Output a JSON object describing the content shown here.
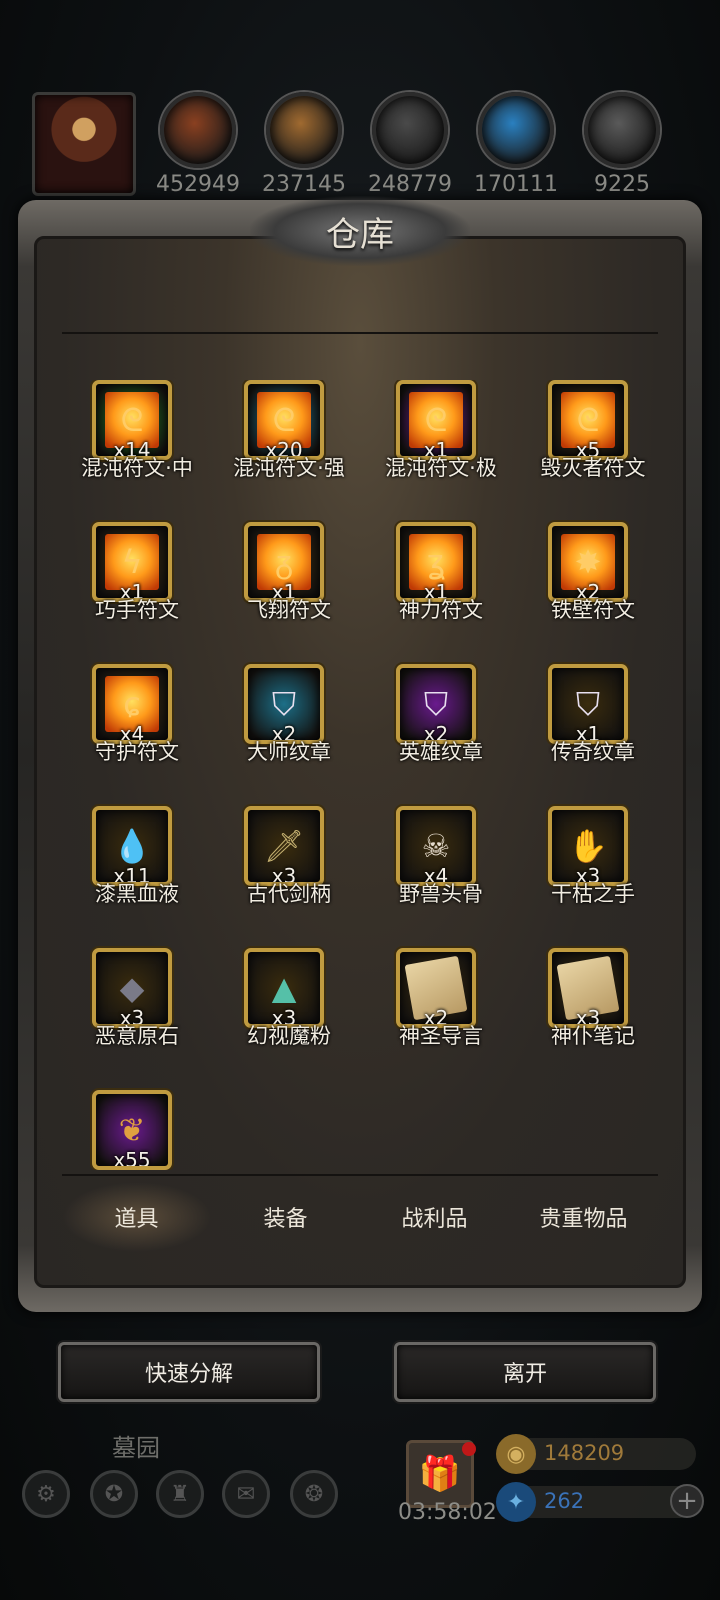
{
  "resources": [
    {
      "icon": "meat-icon",
      "value": "452949",
      "color": "#8a4020"
    },
    {
      "icon": "wood-icon",
      "value": "237145",
      "color": "#a06a30"
    },
    {
      "icon": "stone-icon",
      "value": "248779",
      "color": "#4a4a4a"
    },
    {
      "icon": "crystal-icon",
      "value": "170111",
      "color": "#2a80c0"
    },
    {
      "icon": "iron-icon",
      "value": "9225",
      "color": "#5a5a5a"
    }
  ],
  "panel": {
    "title": "仓库"
  },
  "items": [
    {
      "name": "混沌符文·中",
      "qty": "x14",
      "rarity": "green",
      "glyph": "ᘓ",
      "kind": "rune",
      "icon": "chaos-rune-icon"
    },
    {
      "name": "混沌符文·强",
      "qty": "x20",
      "rarity": "blue",
      "glyph": "ᘓ",
      "kind": "rune",
      "icon": "chaos-rune-icon"
    },
    {
      "name": "混沌符文·极",
      "qty": "x1",
      "rarity": "purple",
      "glyph": "ᘓ",
      "kind": "rune",
      "icon": "chaos-rune-icon"
    },
    {
      "name": "毁灭者符文",
      "qty": "x5",
      "rarity": "gold",
      "glyph": "ᘓ",
      "kind": "rune",
      "icon": "destroyer-rune-icon"
    },
    {
      "name": "巧手符文",
      "qty": "x1",
      "rarity": "gold",
      "glyph": "ϟ",
      "kind": "rune",
      "icon": "dexterity-rune-icon"
    },
    {
      "name": "飞翔符文",
      "qty": "x1",
      "rarity": "gold",
      "glyph": "ᵹ",
      "kind": "rune",
      "icon": "flight-rune-icon"
    },
    {
      "name": "神力符文",
      "qty": "x1",
      "rarity": "gold",
      "glyph": "ʓ",
      "kind": "rune",
      "icon": "power-rune-icon"
    },
    {
      "name": "铁壁符文",
      "qty": "x2",
      "rarity": "gold",
      "glyph": "✸",
      "kind": "rune",
      "icon": "iron-wall-rune-icon"
    },
    {
      "name": "守护符文",
      "qty": "x4",
      "rarity": "gold",
      "glyph": "ɕ",
      "kind": "rune",
      "icon": "guard-rune-icon"
    },
    {
      "name": "大师纹章",
      "qty": "x2",
      "rarity": "blue",
      "glyph": "⛉",
      "kind": "badge",
      "icon": "master-emblem-icon"
    },
    {
      "name": "英雄纹章",
      "qty": "x2",
      "rarity": "purple",
      "glyph": "⛉",
      "kind": "badge",
      "icon": "hero-emblem-icon"
    },
    {
      "name": "传奇纹章",
      "qty": "x1",
      "rarity": "gold",
      "glyph": "⛉",
      "kind": "badge",
      "icon": "legend-emblem-icon"
    },
    {
      "name": "漆黑血液",
      "qty": "x11",
      "rarity": "gold",
      "glyph": "💧",
      "kind": "blood",
      "icon": "black-blood-icon"
    },
    {
      "name": "古代剑柄",
      "qty": "x3",
      "rarity": "gold",
      "glyph": "🗡",
      "kind": "sword",
      "icon": "sword-hilt-icon"
    },
    {
      "name": "野兽头骨",
      "qty": "x4",
      "rarity": "gold",
      "glyph": "☠",
      "kind": "skull",
      "icon": "beast-skull-icon"
    },
    {
      "name": "干枯之手",
      "qty": "x3",
      "rarity": "gold",
      "glyph": "✋",
      "kind": "hand",
      "icon": "withered-hand-icon"
    },
    {
      "name": "恶意原石",
      "qty": "x3",
      "rarity": "gold",
      "glyph": "◆",
      "kind": "stone",
      "icon": "malice-ore-icon"
    },
    {
      "name": "幻视魔粉",
      "qty": "x3",
      "rarity": "gold",
      "glyph": "▲",
      "kind": "dust",
      "icon": "illusion-dust-icon"
    },
    {
      "name": "神圣导言",
      "qty": "x2",
      "rarity": "gold",
      "glyph": "",
      "kind": "scroll",
      "icon": "holy-scroll-icon"
    },
    {
      "name": "神仆笔记",
      "qty": "x3",
      "rarity": "gold",
      "glyph": "",
      "kind": "scroll",
      "icon": "servant-notes-icon"
    },
    {
      "name": "",
      "qty": "x55",
      "rarity": "purple",
      "glyph": "❦",
      "kind": "wing",
      "icon": "feather-icon"
    }
  ],
  "tabs": [
    "道具",
    "装备",
    "战利品",
    "贵重物品"
  ],
  "buttons": {
    "decompose": "快速分解",
    "leave": "离开"
  },
  "hud": {
    "location": "墓园",
    "timer": "03:58:02",
    "gold": "148209",
    "gems": "262"
  },
  "colors": {
    "green": "#1a7a22",
    "blue": "#1c6f88",
    "purple": "#6a1a8e",
    "gold": "#3a2c0e",
    "gold_text": "#a07a3a",
    "gem_text": "#3a72b8"
  }
}
